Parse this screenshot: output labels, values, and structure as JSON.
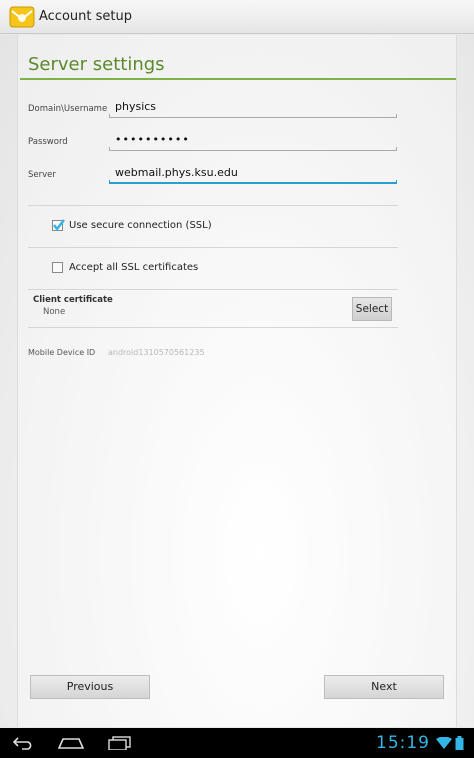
{
  "app": {
    "title": "Account setup",
    "icon": "email-icon"
  },
  "page": {
    "title": "Server settings",
    "accent": "#5a8a2a"
  },
  "form": {
    "domain_label": "Domain\\Username",
    "domain_value": "physics",
    "password_label": "Password",
    "password_value": "••••••••••",
    "server_label": "Server",
    "server_value": "webmail.phys.ksu.edu",
    "ssl_label": "Use secure connection (SSL)",
    "ssl_checked": true,
    "accept_ssl_label": "Accept all SSL certificates",
    "accept_ssl_checked": false,
    "client_cert_label": "Client certificate",
    "client_cert_value": "None",
    "select_label": "Select",
    "device_id_label": "Mobile Device ID",
    "device_id_value": "android1310570561235"
  },
  "buttons": {
    "previous": "Previous",
    "next": "Next"
  },
  "status_bar": {
    "time": "15:19",
    "accent": "#33b5e5"
  }
}
